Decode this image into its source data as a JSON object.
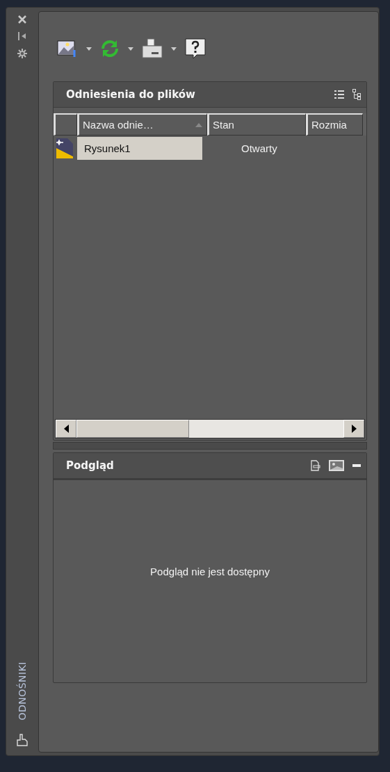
{
  "palette": {
    "title": "ODNOŚNIKI"
  },
  "file_references": {
    "title": "Odniesienia do plików",
    "columns": [
      {
        "label": "Nazwa odnie…",
        "sorted": true
      },
      {
        "label": "Stan",
        "sorted": false
      },
      {
        "label": "Rozmia",
        "sorted": false
      }
    ],
    "rows": [
      {
        "name": "Rysunek1",
        "status": "Otwarty",
        "selected": true
      }
    ]
  },
  "preview": {
    "title": "Podgląd",
    "message": "Podgląd nie jest dostępny"
  }
}
